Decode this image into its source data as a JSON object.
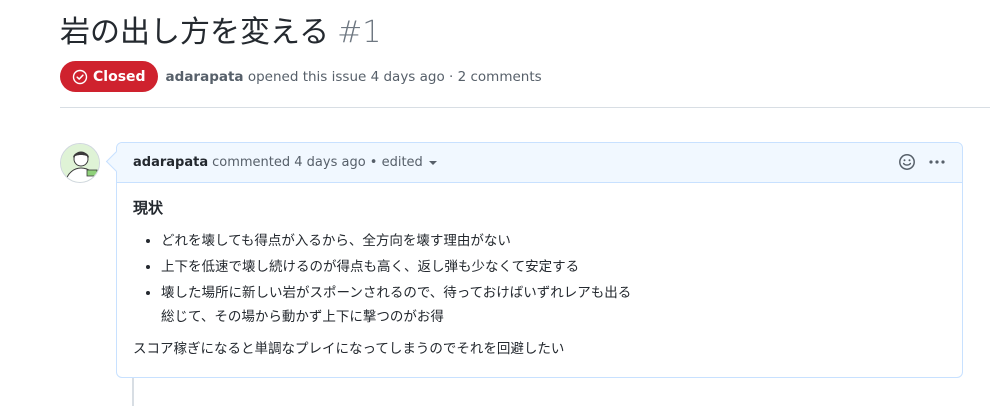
{
  "issue": {
    "title": "岩の出し方を変える",
    "number": "#1",
    "state_label": "Closed",
    "author": "adarapata",
    "meta_text": "opened this issue 4 days ago · 2 comments"
  },
  "comment": {
    "author": "adarapata",
    "meta": "commented 4 days ago • edited",
    "heading": "現状",
    "bullets": [
      "どれを壊しても得点が入るから、全方向を壊す理由がない",
      "上下を低速で壊し続けるのが得点も高く、返し弾も少なくて安定する",
      "壊した場所に新しい岩がスポーンされるので、待っておけばいずれレアも出る"
    ],
    "bullet_3_line2": "総じて、その場から動かず上下に撃つのがお得",
    "paragraph": "スコア稼ぎになると単調なプレイになってしまうのでそれを回避したい"
  },
  "colors": {
    "closed_badge": "#cf222e",
    "header_bg": "#f1f8ff",
    "header_border": "#c8e1ff"
  },
  "icons": {
    "state": "closed-check-icon",
    "reaction": "smiley-icon",
    "more": "kebab-icon",
    "edited": "caret-down-icon"
  }
}
